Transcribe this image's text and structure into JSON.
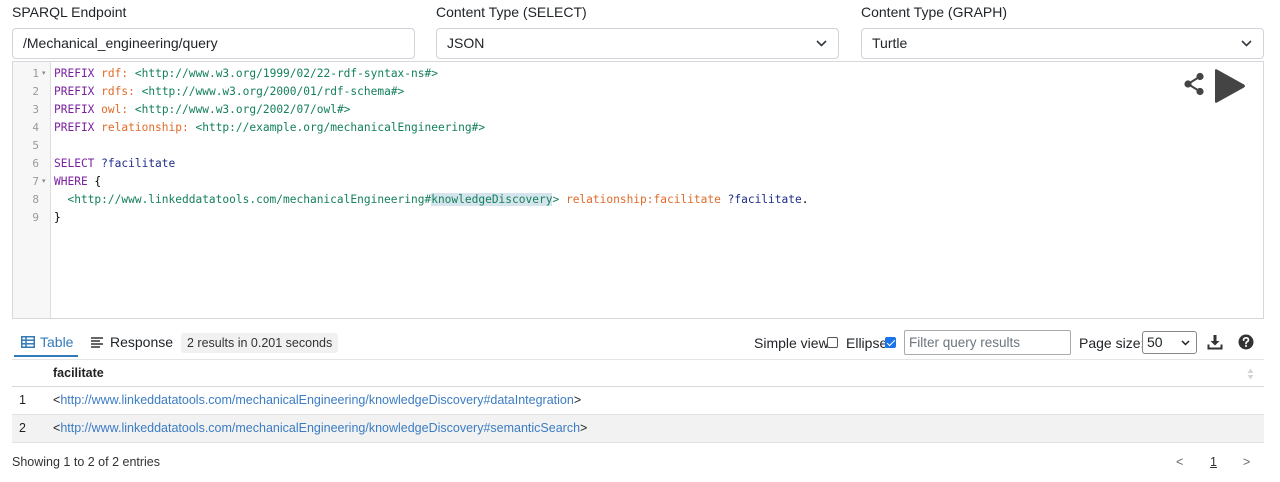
{
  "config": {
    "endpoint_label": "SPARQL Endpoint",
    "endpoint_value": "/Mechanical_engineering/query",
    "select_label": "Content Type (SELECT)",
    "select_value": "JSON",
    "graph_label": "Content Type (GRAPH)",
    "graph_value": "Turtle"
  },
  "editor": {
    "line_numbers": [
      "1",
      "2",
      "3",
      "4",
      "5",
      "6",
      "7",
      "8",
      "9"
    ],
    "lines": [
      {
        "tokens": [
          {
            "t": "PREFIX",
            "c": "kw"
          },
          {
            "t": " ",
            "c": "plain"
          },
          {
            "t": "rdf:",
            "c": "pfx"
          },
          {
            "t": " ",
            "c": "plain"
          },
          {
            "t": "<http://www.w3.org/1999/02/22-rdf-syntax-ns#>",
            "c": "iri"
          }
        ]
      },
      {
        "tokens": [
          {
            "t": "PREFIX",
            "c": "kw"
          },
          {
            "t": " ",
            "c": "plain"
          },
          {
            "t": "rdfs:",
            "c": "pfx"
          },
          {
            "t": " ",
            "c": "plain"
          },
          {
            "t": "<http://www.w3.org/2000/01/rdf-schema#>",
            "c": "iri"
          }
        ]
      },
      {
        "tokens": [
          {
            "t": "PREFIX",
            "c": "kw"
          },
          {
            "t": " ",
            "c": "plain"
          },
          {
            "t": "owl:",
            "c": "pfx"
          },
          {
            "t": " ",
            "c": "plain"
          },
          {
            "t": "<http://www.w3.org/2002/07/owl#>",
            "c": "iri"
          }
        ]
      },
      {
        "tokens": [
          {
            "t": "PREFIX",
            "c": "kw"
          },
          {
            "t": " ",
            "c": "plain"
          },
          {
            "t": "relationship:",
            "c": "pfx"
          },
          {
            "t": " ",
            "c": "plain"
          },
          {
            "t": "<http://example.org/mechanicalEngineering#>",
            "c": "iri"
          }
        ]
      },
      {
        "tokens": []
      },
      {
        "tokens": [
          {
            "t": "SELECT",
            "c": "kw"
          },
          {
            "t": " ",
            "c": "plain"
          },
          {
            "t": "?facilitate",
            "c": "var"
          }
        ]
      },
      {
        "tokens": [
          {
            "t": "WHERE",
            "c": "kw"
          },
          {
            "t": " {",
            "c": "plain"
          }
        ]
      },
      {
        "tokens": [
          {
            "t": "  ",
            "c": "plain"
          },
          {
            "t": "<http://www.linkeddatatools.com/mechanicalEngineering#",
            "c": "iri"
          },
          {
            "t": "knowledgeDiscovery",
            "c": "iri hl"
          },
          {
            "t": ">",
            "c": "iri"
          },
          {
            "t": " ",
            "c": "plain"
          },
          {
            "t": "relationship:facilitate",
            "c": "pfx"
          },
          {
            "t": " ",
            "c": "plain"
          },
          {
            "t": "?facilitate",
            "c": "var"
          },
          {
            "t": ".",
            "c": "plain"
          }
        ]
      },
      {
        "tokens": [
          {
            "t": "}",
            "c": "plain"
          }
        ]
      }
    ],
    "fold_marker": "▾"
  },
  "toolbar": {
    "tab_table": "Table",
    "tab_response": "Response",
    "results_badge": "2 results in 0.201 seconds",
    "simple_view_label": "Simple view",
    "simple_view_checked": false,
    "ellipse_label": "Ellipse",
    "ellipse_checked": true,
    "filter_placeholder": "Filter query results",
    "page_size_label": "Page size:",
    "page_size_value": "50"
  },
  "table": {
    "column": "facilitate",
    "rows": [
      {
        "index": "1",
        "lt": "<",
        "iri": "http://www.linkeddatatools.com/mechanicalEngineering/knowledgeDiscovery#dataIntegration",
        "gt": ">"
      },
      {
        "index": "2",
        "lt": "<",
        "iri": "http://www.linkeddatatools.com/mechanicalEngineering/knowledgeDiscovery#semanticSearch",
        "gt": ">"
      }
    ]
  },
  "footer": {
    "info": "Showing 1 to 2 of 2 entries",
    "prev": "<",
    "page": "1",
    "next": ">"
  },
  "colors": {
    "keyword": "#7a1fa0",
    "prefix": "#e06b2a",
    "iri": "#15805a",
    "variable": "#1f2d8a",
    "link": "#3b7cc4",
    "accent": "#337ab7"
  }
}
